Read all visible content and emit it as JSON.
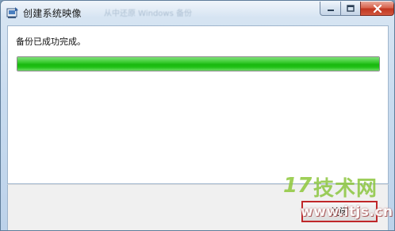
{
  "window": {
    "title": "创建系统映像",
    "background_title_blurred": "从中还原 Windows 备份",
    "controls": {
      "minimize": "─",
      "maximize": "□",
      "close": "✕"
    }
  },
  "content": {
    "status_text": "备份已成功完成。",
    "progress_percent": 100,
    "progress_color": "#1fbf15"
  },
  "footer": {
    "close_button_label": "关闭",
    "highlight_color": "#c0282a"
  },
  "watermark": {
    "logo_glyph": "17",
    "site_name": "技术网",
    "url": "www.itjs.cn"
  },
  "icons": [
    "app-icon",
    "minimize-icon",
    "maximize-icon",
    "close-icon"
  ]
}
